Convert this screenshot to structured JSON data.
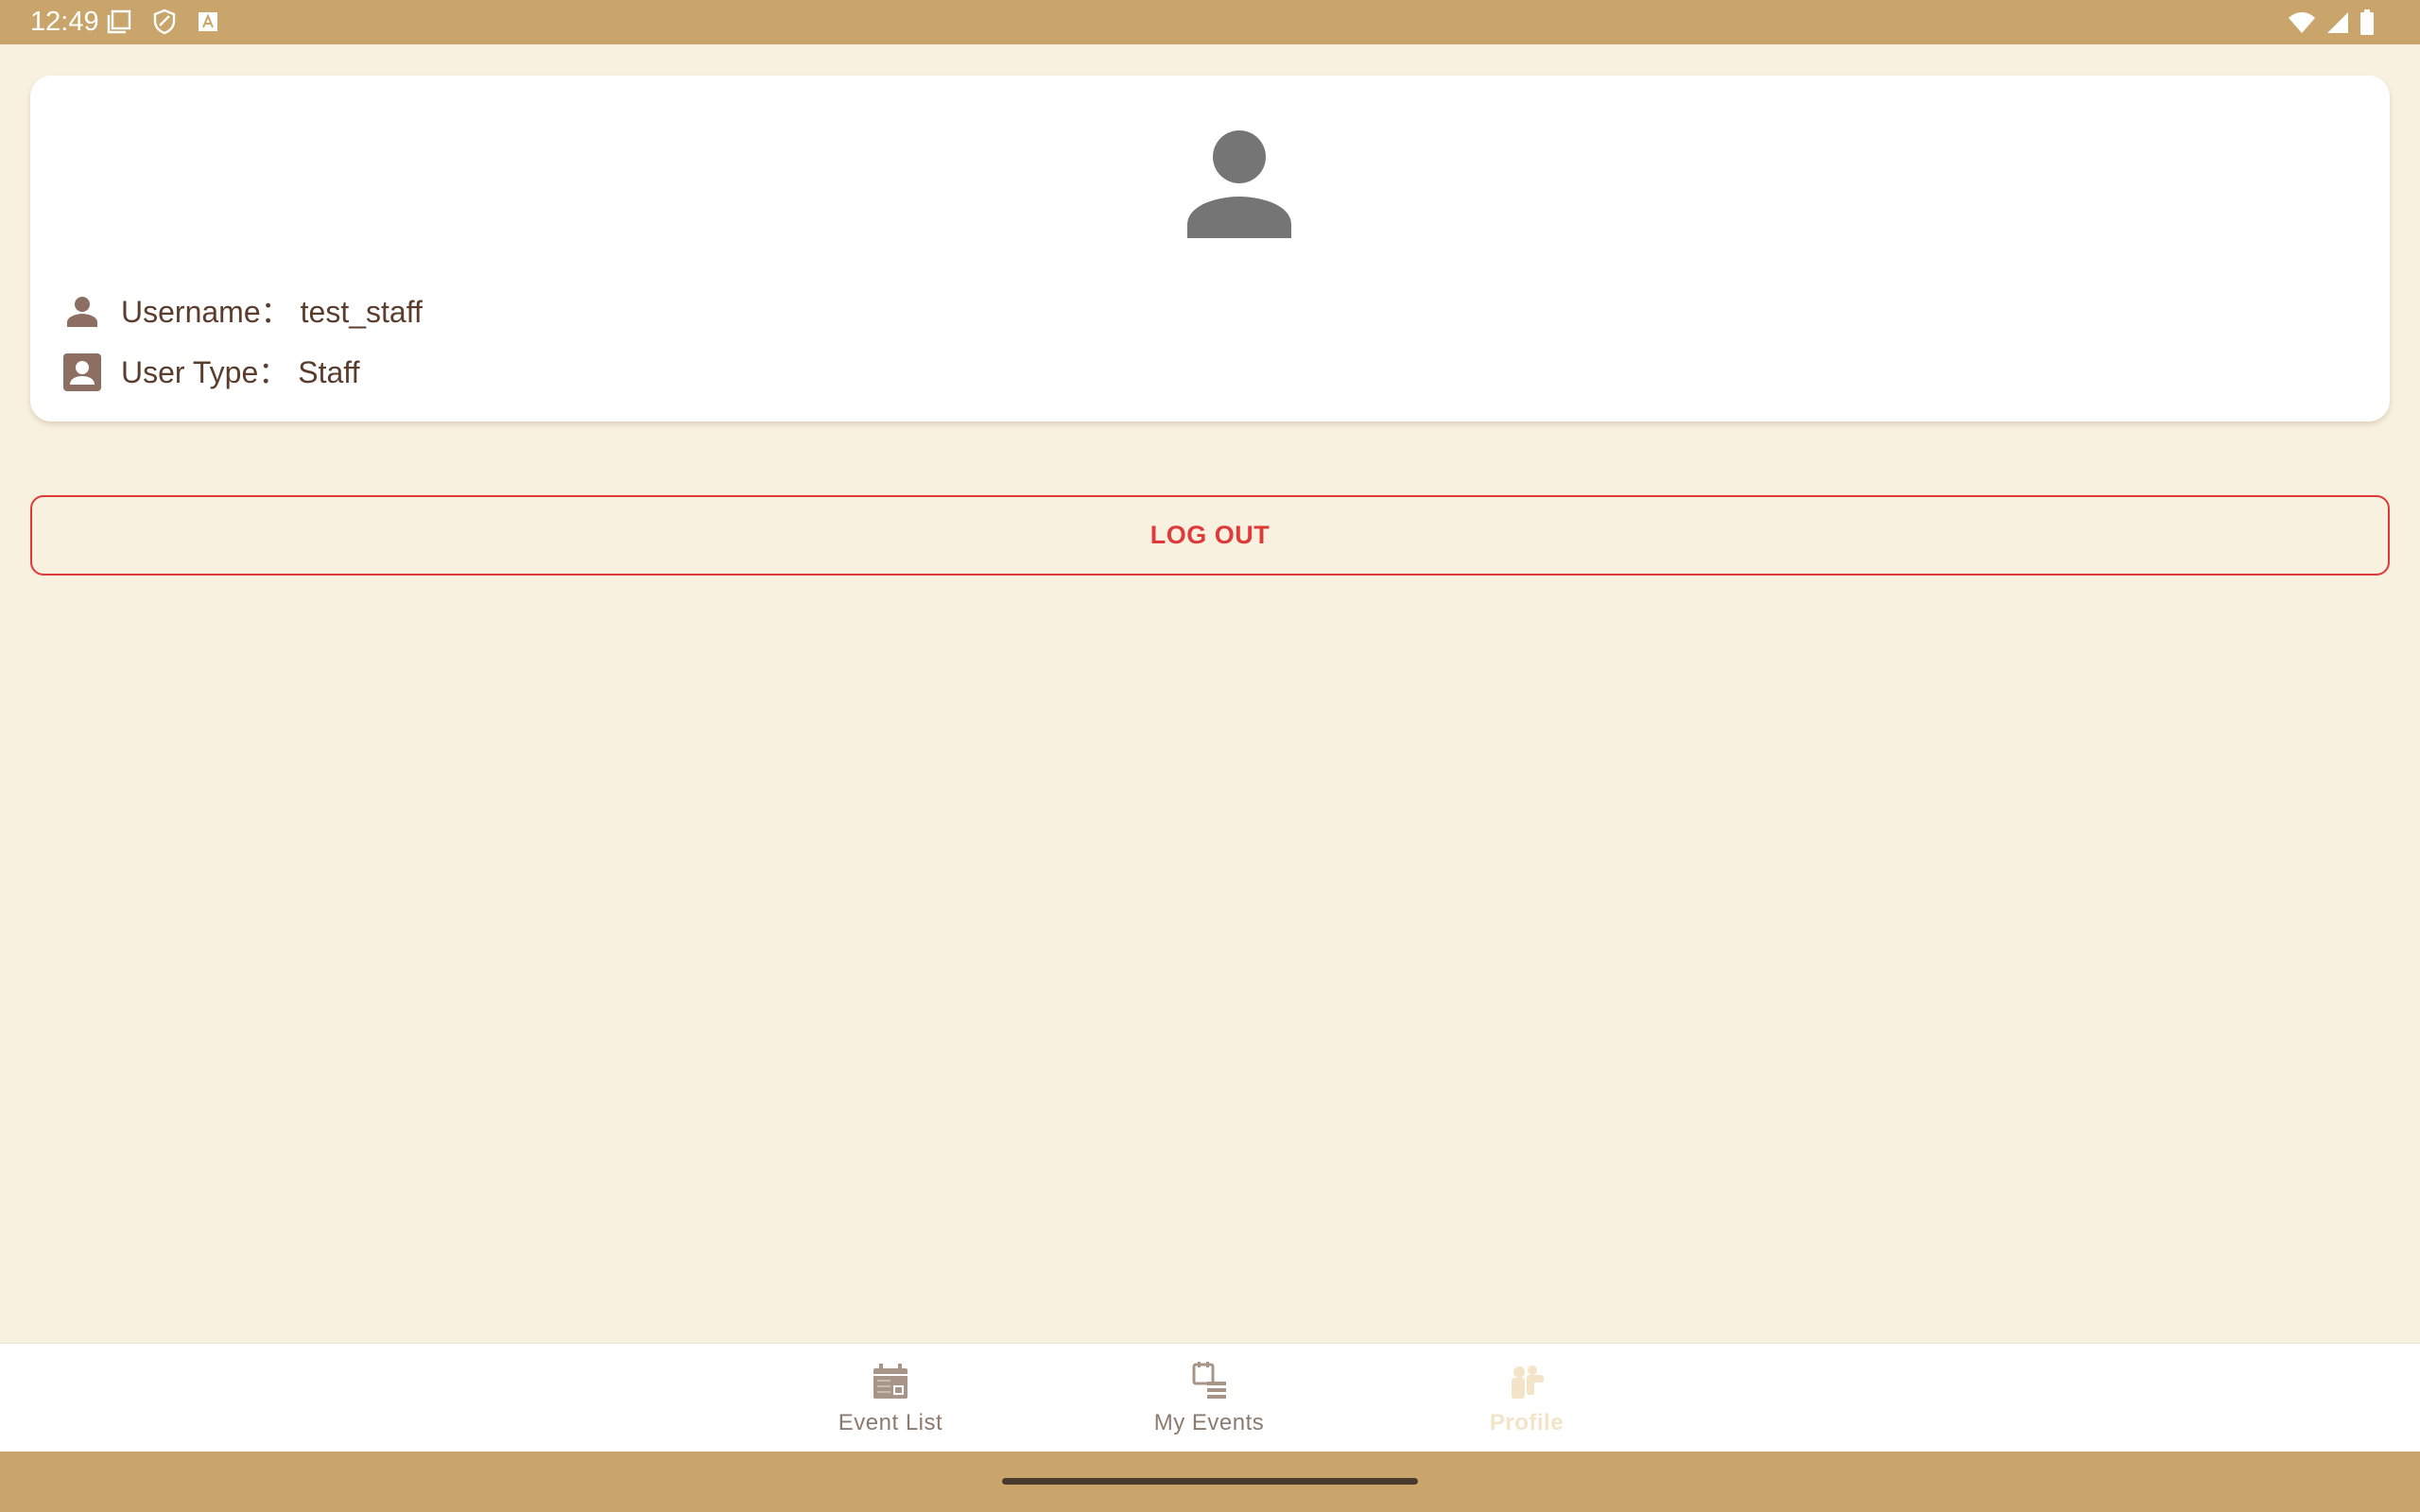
{
  "status_bar": {
    "time": "12:49",
    "left_icons": [
      "screen-icon",
      "shield-icon",
      "keyboard-a-icon"
    ],
    "right_icons": [
      "wifi-icon",
      "cellular-icon",
      "battery-icon"
    ]
  },
  "profile": {
    "avatar_icon": "person-icon",
    "username_label": "Username：",
    "username_value": "test_staff",
    "user_type_label": "User Type：",
    "user_type_value": "Staff"
  },
  "actions": {
    "logout_label": "LOG OUT"
  },
  "bottom_nav": {
    "items": [
      {
        "label": "Event List",
        "icon": "calendar-icon",
        "active": false
      },
      {
        "label": "My Events",
        "icon": "event-list-icon",
        "active": false
      },
      {
        "label": "Profile",
        "icon": "people-icon",
        "active": true
      }
    ]
  },
  "colors": {
    "bar_background": "#c9a56b",
    "page_background": "#f9f1e0",
    "text_brown": "#5b3d2e",
    "logout_red": "#e0393a",
    "nav_inactive": "#8d7a6e",
    "nav_active": "#f3e3c7"
  }
}
